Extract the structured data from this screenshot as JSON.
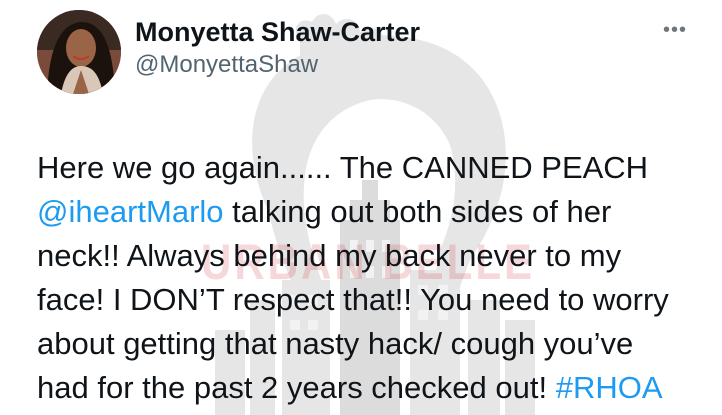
{
  "tweet": {
    "display_name": "Monyetta Shaw-Carter",
    "handle": "@MonyettaShaw",
    "more_icon": "more-horizontal-icon",
    "avatar_icon": "profile-photo",
    "lines": [
      {
        "plain": "Here we go again...... The CANNED PEACH"
      },
      {
        "link": "@iheartMarlo",
        "text": " talking out both sides of her"
      },
      {
        "plain": "neck!! Always behind my back never to my"
      },
      {
        "plain": "face! I DON’T respect that!! You need to worry"
      },
      {
        "plain": "about getting that nasty hack/ cough you’ve"
      },
      {
        "text": "had for the past 2 years checked out! ",
        "hashtag": "#RHOA"
      }
    ]
  },
  "watermark": {
    "text": "URBAN BELLE"
  },
  "colors": {
    "text": "#0f1419",
    "secondary": "#536471",
    "link": "#1d9bf0",
    "watermark": "#d63a46"
  }
}
